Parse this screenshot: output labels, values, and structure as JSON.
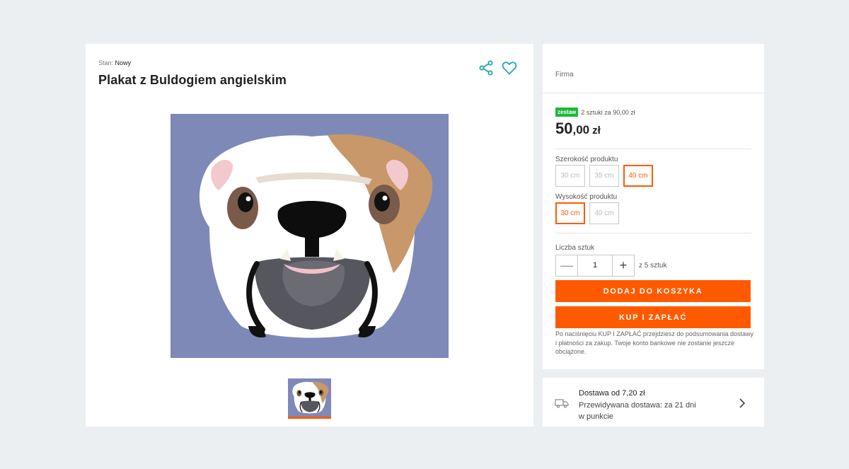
{
  "product": {
    "condition_label": "Stan:",
    "condition_value": "Nowy",
    "title": "Plakat z Buldogiem angielskim",
    "share_icon": "share-icon",
    "favorite_icon": "heart-icon",
    "image_subject": "english-bulldog-poster",
    "thumbnail_subject": "english-bulldog-poster-thumbnail"
  },
  "seller": {
    "name": "Firma"
  },
  "pricing": {
    "badge": "zestaw",
    "promo": "2 sztuki za 90,00 zł",
    "price_int": "50",
    "price_dec": ",00",
    "currency": "zł"
  },
  "options": {
    "width_label": "Szerokość produktu",
    "widths": [
      {
        "label": "30 cm",
        "selected": false
      },
      {
        "label": "35 cm",
        "selected": false
      },
      {
        "label": "40 cm",
        "selected": true
      }
    ],
    "height_label": "Wysokość produktu",
    "heights": [
      {
        "label": "30 cm",
        "selected": true
      },
      {
        "label": "40 cm",
        "selected": false
      }
    ]
  },
  "quantity": {
    "label": "Liczba sztuk",
    "minus": "—",
    "value": "1",
    "plus": "+",
    "of": "z 5 sztuk"
  },
  "actions": {
    "add_to_cart": "DODAJ DO KOSZYKA",
    "buy_now": "KUP I ZAPŁAĆ",
    "note": "Po naciśnięciu KUP I ZAPŁAĆ przejdziesz do podsumowania dostawy i płatności za zakup. Twoje konto bankowe nie zostanie jeszcze obciążone."
  },
  "delivery": {
    "line1": "Dostawa od 7,20 zł",
    "line2": "Przewidywana dostawa: za 21 dni",
    "line3": "w punkcie",
    "icon": "truck-icon",
    "arrow_icon": "chevron-right-icon"
  },
  "colors": {
    "accent": "#ff5a00",
    "badge": "#1db839",
    "icon_teal": "#1fa6a8",
    "poster_bg": "#7e89b8"
  }
}
